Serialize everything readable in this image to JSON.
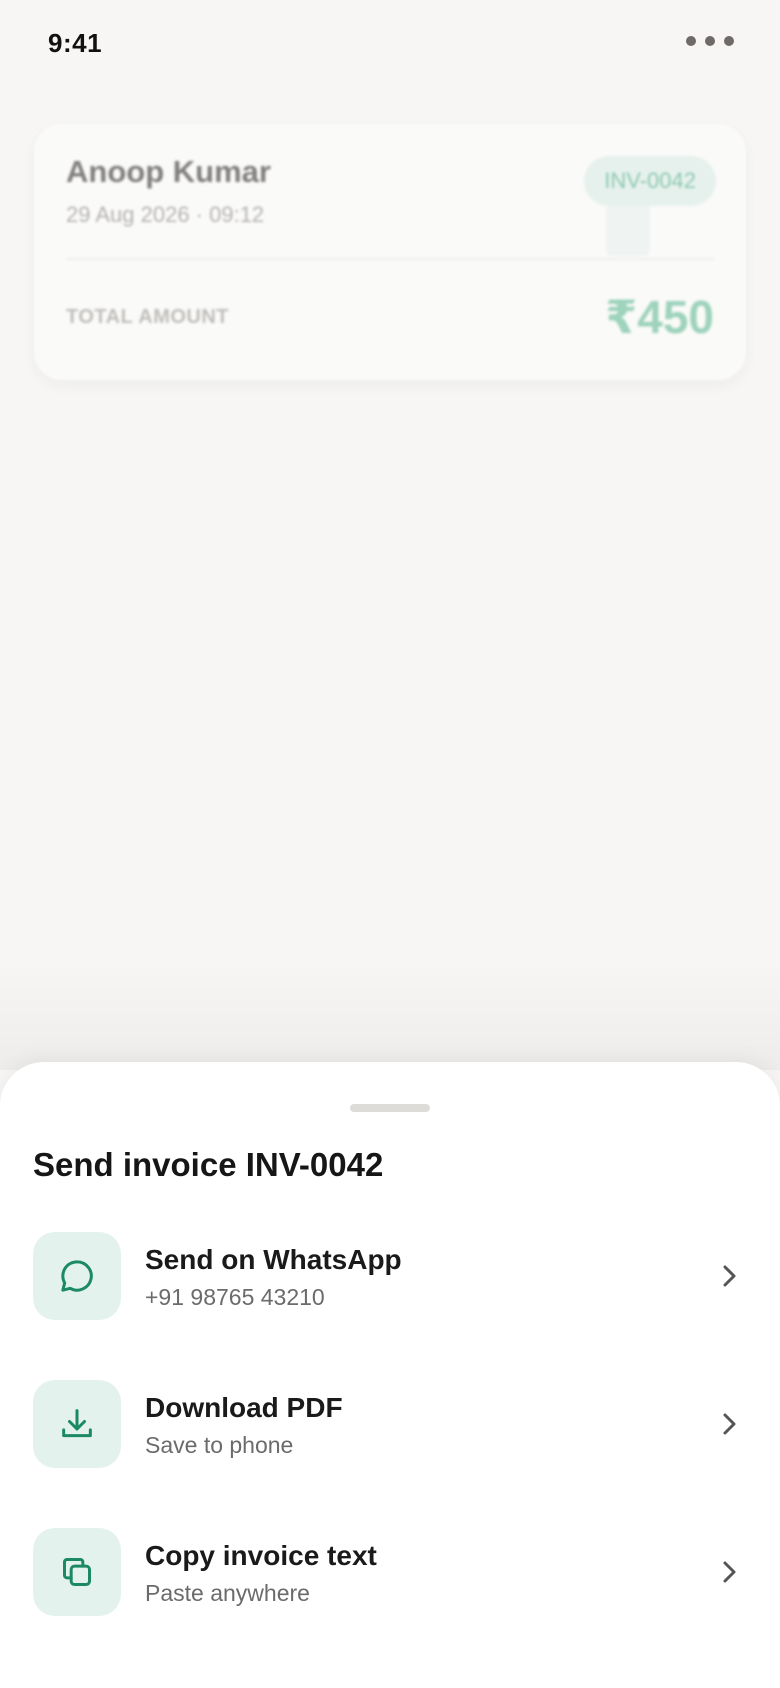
{
  "status": {
    "time": "9:41"
  },
  "card": {
    "customer": "Anoop Kumar",
    "date": "29 Aug 2026 · 09:12",
    "invoice_id": "INV-0042",
    "total_label": "TOTAL AMOUNT",
    "total_amount": "₹450"
  },
  "sheet": {
    "title": "Send invoice INV-0042",
    "options": [
      {
        "title": "Send on WhatsApp",
        "subtitle": "+91 98765 43210",
        "icon": "chat-bubble-icon"
      },
      {
        "title": "Download PDF",
        "subtitle": "Save to phone",
        "icon": "download-icon"
      },
      {
        "title": "Copy invoice text",
        "subtitle": "Paste anywhere",
        "icon": "copy-icon"
      }
    ]
  },
  "colors": {
    "accent": "#1b8a63",
    "icon_bg": "#e4f2ee",
    "background": "#f7f6f4"
  }
}
